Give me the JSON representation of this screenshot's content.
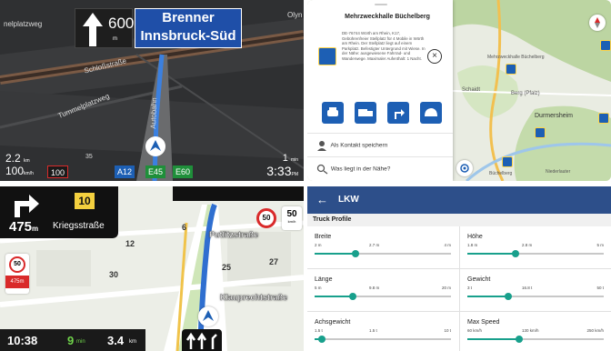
{
  "panel1": {
    "distance": "600",
    "distance_unit": "m",
    "destination_line1": "Brenner",
    "destination_line2": "Innsbruck-Süd",
    "streets": [
      "nelplatzweg",
      "Schloßstraße",
      "Tummelplatzweg",
      "Autobahn"
    ],
    "corner_label": "Olyn",
    "left_top": "2.2",
    "left_top_unit": "km",
    "left_bottom": "100",
    "left_bottom_unit": "km/h",
    "speed_limit": "100",
    "road_badges": [
      "A12",
      "E45",
      "E60"
    ],
    "right_top": "1",
    "right_top_unit": "min",
    "time": "3:33",
    "time_suffix": "PM",
    "small_number": "35"
  },
  "panel2": {
    "place_title": "Mehrzweckhalle Büchelberg",
    "place_body": "DE-76744 Wörth am Rhein, K17, Gebührenfreier Stellplatz für 4 Mobile in Wörth am Rhein. Der Stellplatz liegt auf einem Parkplatz. Befestigter Untergrund mit Wiese. In der Nähe: ausgewiesene Fahrrad- und Wanderwege. Maximaler Aufenthalt: 1 Nacht.",
    "close_icon": "×",
    "row1": "Als Kontakt speichern",
    "row2": "Was liegt in der Nähe?",
    "places": [
      "Mehrzweckhalle Büchelberg",
      "Schaidt",
      "Berg (Pfalz)",
      "Durmersheim",
      "Niederlauter",
      "Büchelberg"
    ]
  },
  "panel3": {
    "distance": "475",
    "distance_unit": "m",
    "street": "Kriegsstraße",
    "lane_number": "10",
    "speed_limit": "50",
    "speed_limit_alt": "50",
    "speed_limit_alt_unit": "km/h",
    "left_sign_value": "50",
    "left_sign_distance": "475m",
    "numbers": [
      "6",
      "12",
      "25",
      "27",
      "30"
    ],
    "streets": [
      "Putlitzstraße",
      "Klauprechtstraße"
    ],
    "time": "10:38",
    "minutes": "9",
    "minutes_unit": "min",
    "distance_remaining": "3.4",
    "distance_remaining_unit": "km"
  },
  "panel4": {
    "back_icon": "←",
    "title": "LKW",
    "section": "Truck Profile",
    "settings": [
      {
        "label": "Breite",
        "ticks": [
          "2 m",
          "2.7 m",
          "4 m"
        ],
        "value_fraction": 0.3
      },
      {
        "label": "Höhe",
        "ticks": [
          "1.8 m",
          "2.8 m",
          "5 m"
        ],
        "value_fraction": 0.35
      },
      {
        "label": "Länge",
        "ticks": [
          "5 m",
          "9.8 m",
          "20 m"
        ],
        "value_fraction": 0.28
      },
      {
        "label": "Gewicht",
        "ticks": [
          "3 t",
          "16.8 t",
          "50 t"
        ],
        "value_fraction": 0.3
      },
      {
        "label": "Achsgewicht",
        "ticks": [
          "1.5 t",
          "1.5 t",
          "10 t"
        ],
        "value_fraction": 0.05
      },
      {
        "label": "Max Speed",
        "ticks": [
          "60 km/h",
          "130 km/h",
          "250 km/h"
        ],
        "value_fraction": 0.38
      }
    ]
  }
}
